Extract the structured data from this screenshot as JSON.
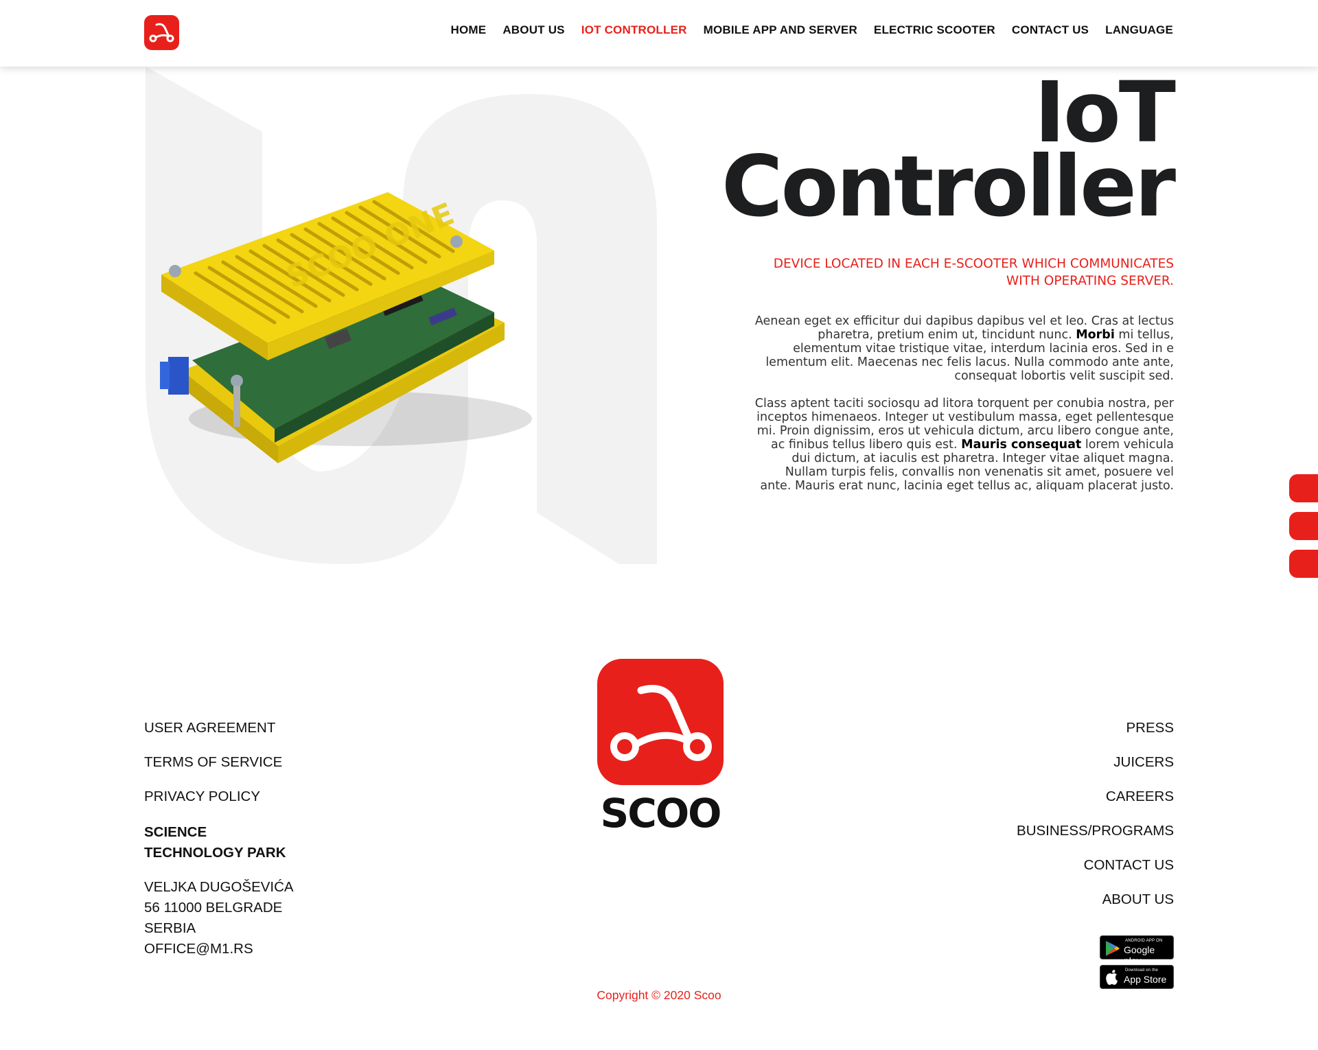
{
  "nav": {
    "items": [
      {
        "label": "HOME"
      },
      {
        "label": "ABOUT US"
      },
      {
        "label": "IOT CONTROLLER"
      },
      {
        "label": "MOBILE APP AND SERVER"
      },
      {
        "label": "ELECTRIC SCOOTER"
      },
      {
        "label": "CONTACT US"
      },
      {
        "label": "LANGUAGE"
      }
    ],
    "active": "IOT CONTROLLER"
  },
  "hero": {
    "title_line1": "IoT",
    "title_line2": "Controller",
    "subtitle": "DEVICE LOCATED IN EACH E-SCOOTER WHICH COMMUNICATES WITH OPERATING SERVER.",
    "p1_a": "Aenean eget ex efficitur dui dapibus dapibus vel et leo. Cras at lectus pharetra, pretium enim ut, tincidunt nunc. ",
    "p1_bold": "Morbi",
    "p1_b": " mi tellus, elementum vitae tristique vitae, interdum lacinia eros. Sed in e lementum elit. Maecenas nec felis lacus. Nulla commodo ante ante, consequat lobortis velit suscipit sed.",
    "p2_a": "Class aptent taciti sociosqu ad litora torquent per conubia nostra, per inceptos himenaeos. Integer ut vestibulum massa, eget pellentesque mi. Proin dignissim, eros ut vehicula dictum, arcu libero congue ante, ac finibus tellus libero quis est. ",
    "p2_bold": "Mauris consequat",
    "p2_b": " lorem vehicula dui dictum, at iaculis est pharetra. Integer vitae aliquet magna. Nullam turpis felis, convallis non venenatis sit amet, posuere vel ante. Mauris erat nunc, lacinia eget tellus ac, aliquam placerat justo.",
    "device_label": "SCOO ONE"
  },
  "footer": {
    "left_links": [
      "USER AGREEMENT",
      "TERMS OF SERVICE",
      "PRIVACY POLICY"
    ],
    "org_line1": "SCIENCE",
    "org_line2": "TECHNOLOGY PARK",
    "address": [
      "VELJKA DUGOŠEVIĆA",
      "56 11000 BELGRADE",
      "SERBIA",
      "OFFICE@M1.RS"
    ],
    "brand": "SCOO",
    "right_links": [
      "PRESS",
      "JUICERS",
      "CAREERS",
      "BUSINESS/PROGRAMS",
      "CONTACT US",
      "ABOUT US"
    ],
    "google_small": "ANDROID APP ON",
    "google_big": "Google play",
    "apple_small": "Download on the",
    "apple_big": "App Store",
    "copyright": "Copyright © 2020 Scoo"
  },
  "colors": {
    "accent": "#e8201b",
    "title": "#1d1e20",
    "bg_shape": "#f2f2f2",
    "device_yellow": "#f2d20c"
  },
  "icons": [
    "scoo-logo-icon",
    "google-play-icon",
    "apple-icon",
    "social-icon"
  ]
}
